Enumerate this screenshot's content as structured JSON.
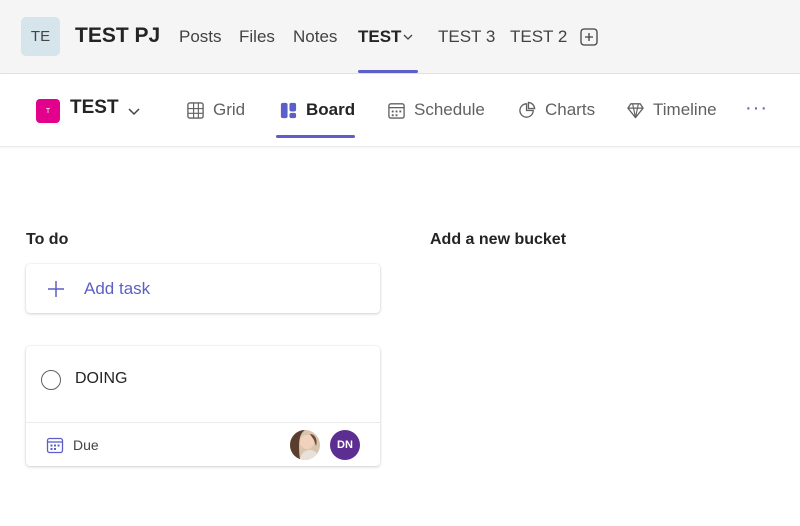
{
  "channel_header": {
    "team_initials": "TE",
    "team_name": "TEST PJ",
    "tabs": [
      {
        "label": "Posts"
      },
      {
        "label": "Files"
      },
      {
        "label": "Notes"
      },
      {
        "label": "TEST",
        "active": true
      },
      {
        "label": "TEST 3"
      },
      {
        "label": "TEST 2"
      }
    ],
    "add_tab_icon": "plus-square-icon",
    "accent_color": "#5b5fc7"
  },
  "planner_toolbar": {
    "plan_name": "TEST",
    "plan_swatch_letter": "T",
    "plan_color": "#e3008c",
    "views": [
      {
        "label": "Grid",
        "icon": "grid-icon"
      },
      {
        "label": "Board",
        "icon": "board-icon",
        "active": true
      },
      {
        "label": "Schedule",
        "icon": "schedule-icon"
      },
      {
        "label": "Charts",
        "icon": "charts-icon"
      },
      {
        "label": "Timeline",
        "icon": "timeline-icon"
      }
    ],
    "more_label": "···"
  },
  "board": {
    "buckets": [
      {
        "title": "To do",
        "add_task_label": "Add task",
        "tasks": [
          {
            "title": "DOING",
            "due_label": "Due",
            "assignees": [
              {
                "type": "photo"
              },
              {
                "initials": "DN",
                "color": "#5c2e91"
              }
            ]
          }
        ]
      }
    ],
    "new_bucket_label": "Add a new bucket"
  }
}
